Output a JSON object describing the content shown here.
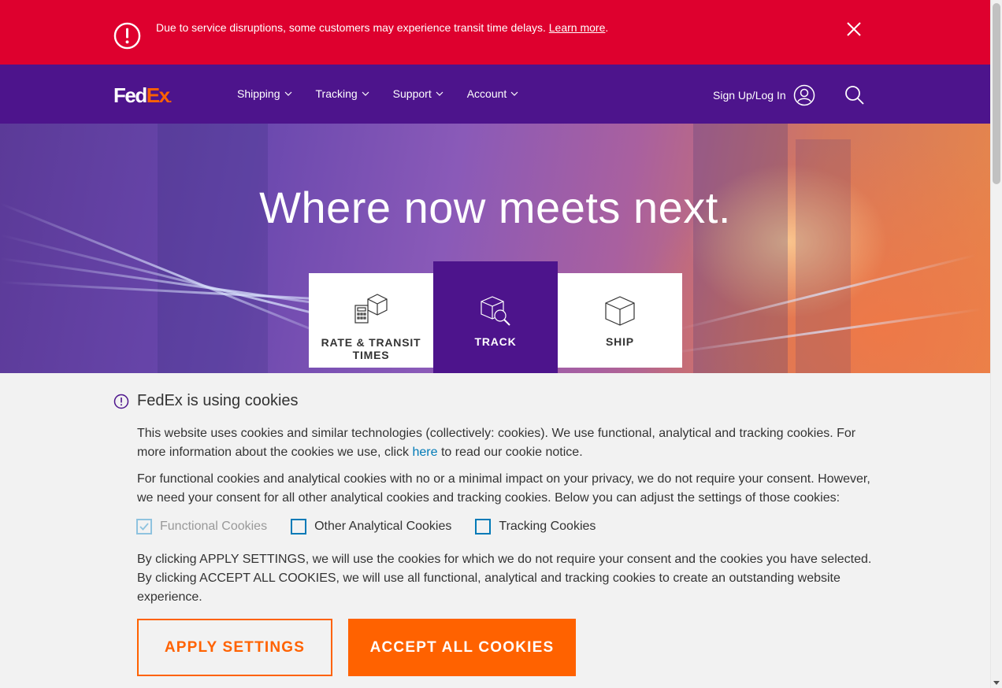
{
  "alert": {
    "message": "Due to service disruptions, some customers may experience transit time delays.",
    "link_text": "Learn more",
    "trailing": ".",
    "close_icon": "close-icon",
    "bg_color": "#de002e"
  },
  "nav": {
    "logo_fed": "Fed",
    "logo_ex": "Ex",
    "logo_dot": ".",
    "items": [
      {
        "label": "Shipping"
      },
      {
        "label": "Tracking"
      },
      {
        "label": "Support"
      },
      {
        "label": "Account"
      }
    ],
    "signin_label": "Sign Up/Log In",
    "bg_color": "#4d148c",
    "accent_color": "#ff6200"
  },
  "hero": {
    "title": "Where now meets next.",
    "tiles": [
      {
        "label_line1": "RATE & TRANSIT",
        "label_line2": "TIMES",
        "icon": "calculator-box-icon"
      },
      {
        "label_line1": "TRACK",
        "label_line2": "",
        "icon": "box-search-icon",
        "active": true
      },
      {
        "label_line1": "SHIP",
        "label_line2": "",
        "icon": "box-icon"
      }
    ]
  },
  "cookie": {
    "heading": "FedEx is using cookies",
    "para1_before": "This website uses cookies and similar technologies (collectively: cookies). We use functional, analytical and tracking cookies. For more information about the cookies we use, click ",
    "para1_link": "here",
    "para1_after": " to read our cookie notice.",
    "para2": "For functional cookies and analytical cookies with no or a minimal impact on your privacy, we do not require your consent. However, we need your consent for all other analytical cookies and tracking cookies. Below you can adjust the settings of those cookies:",
    "options": [
      {
        "label": "Functional Cookies",
        "checked": true,
        "disabled": true
      },
      {
        "label": "Other Analytical Cookies",
        "checked": false
      },
      {
        "label": "Tracking Cookies",
        "checked": false
      }
    ],
    "para3": "By clicking APPLY SETTINGS, we will use the cookies for which we do not require your consent and the cookies you have selected. By clicking ACCEPT ALL COOKIES, we will use all functional, analytical and tracking cookies to create an outstanding website experience.",
    "apply_label": "APPLY SETTINGS",
    "accept_label": "ACCEPT ALL COOKIES"
  }
}
